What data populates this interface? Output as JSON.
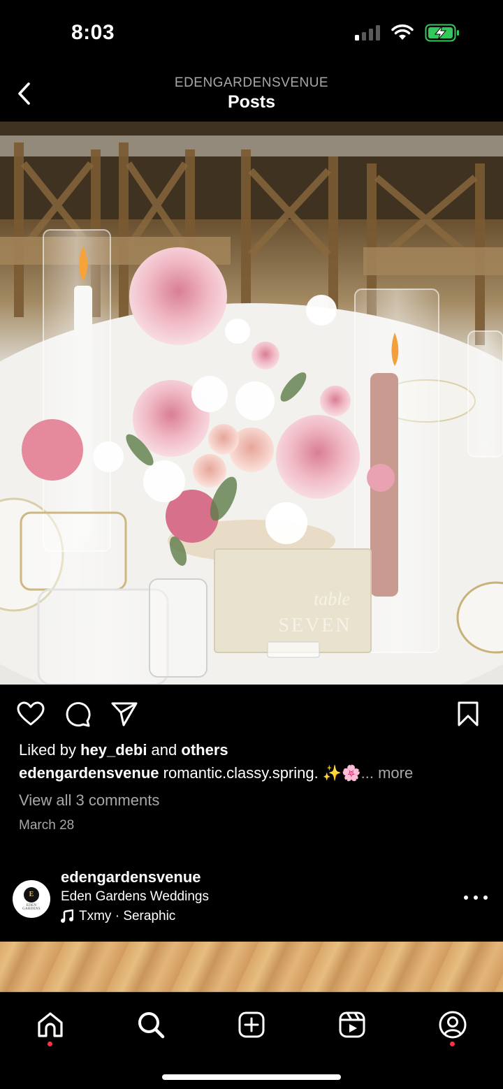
{
  "status": {
    "time": "8:03"
  },
  "header": {
    "account": "EDENGARDENSVENUE",
    "title": "Posts"
  },
  "post": {
    "photo_alt": "Table seven floral centerpiece",
    "table_card": {
      "script": "table",
      "number": "SEVEN"
    },
    "likes": {
      "prefix": "Liked by ",
      "user": "hey_debi",
      "middle": " and ",
      "others": "others"
    },
    "caption": {
      "user": "edengardensvenue",
      "text": " romantic.classy.spring. ✨🌸",
      "more": "... more"
    },
    "comments_link": "View all 3 comments",
    "date": "March 28"
  },
  "next_post": {
    "username": "edengardensvenue",
    "subtitle": "Eden Gardens Weddings",
    "audio": "Txmy · Seraphic",
    "avatar_mark": "E",
    "avatar_text_1": "EDEN",
    "avatar_text_2": "GARDENS"
  },
  "icons": {
    "back": "chevron-left-icon",
    "like": "heart-icon",
    "comment": "comment-icon",
    "share": "send-icon",
    "save": "bookmark-icon",
    "home": "home-icon",
    "search": "search-icon",
    "create": "plus-square-icon",
    "reels": "reels-icon",
    "profile": "profile-icon",
    "music": "music-note-icon"
  },
  "colors": {
    "background": "#000000",
    "muted_text": "#a8a8a8",
    "notification": "#ff3040",
    "battery": "#34c759"
  }
}
